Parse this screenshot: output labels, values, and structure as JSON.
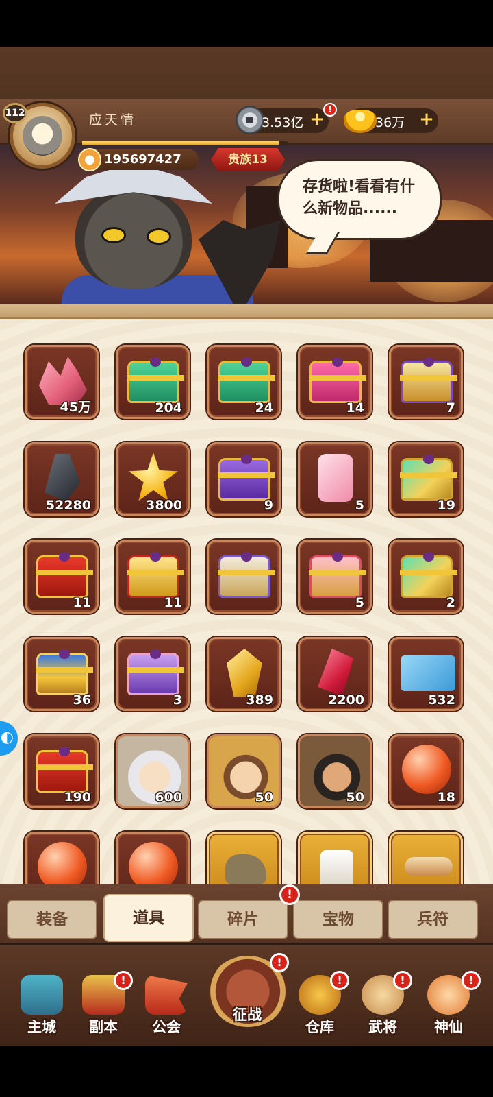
{
  "player": {
    "level": "112",
    "name": "应天情",
    "power": "195697427",
    "noble": "贵族13",
    "exp_fraction": 0.96
  },
  "currencies": {
    "silver": "3.53亿",
    "silver_plus": "+",
    "silver_alert": "!",
    "gold": "36万",
    "gold_plus": "+"
  },
  "banner": {
    "speech": "存货啦!看看有什么新物品......"
  },
  "inventory": [
    {
      "count": "45万",
      "art": "pink-crystal"
    },
    {
      "count": "204",
      "art": "green-chest"
    },
    {
      "count": "24",
      "art": "green-chest"
    },
    {
      "count": "14",
      "art": "pink-chest"
    },
    {
      "count": "7",
      "art": "winged-helm-chest"
    },
    {
      "count": "52280",
      "art": "iron-ingot"
    },
    {
      "count": "3800",
      "art": "gold-star"
    },
    {
      "count": "9",
      "art": "purple-chest"
    },
    {
      "count": "5",
      "art": "pink-token"
    },
    {
      "count": "19",
      "art": "jade-gold-chest"
    },
    {
      "count": "11",
      "art": "red-gold-chest"
    },
    {
      "count": "11",
      "art": "gold-winged-chest"
    },
    {
      "count": "",
      "art": "silver-winged-chest"
    },
    {
      "count": "5",
      "art": "pink-gold-chest"
    },
    {
      "count": "2",
      "art": "jade-gold-chest"
    },
    {
      "count": "36",
      "art": "blue-gold-chest"
    },
    {
      "count": "3",
      "art": "open-purple-chest"
    },
    {
      "count": "389",
      "art": "gold-crystal"
    },
    {
      "count": "2200",
      "art": "red-gem"
    },
    {
      "count": "532",
      "art": "mp-ticket"
    },
    {
      "count": "190",
      "art": "red-gold-chest"
    },
    {
      "count": "600",
      "art": "white-sage-portrait"
    },
    {
      "count": "50",
      "art": "laughing-general-portrait"
    },
    {
      "count": "50",
      "art": "bearded-general-portrait"
    },
    {
      "count": "18",
      "art": "red-orb"
    },
    {
      "count": "",
      "art": "red-orb"
    },
    {
      "count": "",
      "art": "red-orb"
    },
    {
      "count": "",
      "art": "beast-card"
    },
    {
      "count": "",
      "art": "tile-card"
    },
    {
      "count": "",
      "art": "scroll-card"
    }
  ],
  "tabs": [
    {
      "label": "装备"
    },
    {
      "label": "道具"
    },
    {
      "label": "碎片"
    },
    {
      "label": "宝物"
    },
    {
      "label": "兵符"
    }
  ],
  "tab_alert": "!",
  "nav": [
    {
      "label": "主城",
      "alert": ""
    },
    {
      "label": "副本",
      "alert": "!"
    },
    {
      "label": "公会",
      "alert": ""
    },
    {
      "label": "征战",
      "alert": "!"
    },
    {
      "label": "仓库",
      "alert": "!"
    },
    {
      "label": "武将",
      "alert": "!"
    },
    {
      "label": "神仙",
      "alert": "!"
    }
  ],
  "colors": {
    "header": "#5f3c28",
    "panel": "#f5ecd9",
    "slot": "#6e2c1d",
    "alert": "#d8231a",
    "float_button": "#1e9df0"
  },
  "float_button_icon": "gamepad-icon"
}
